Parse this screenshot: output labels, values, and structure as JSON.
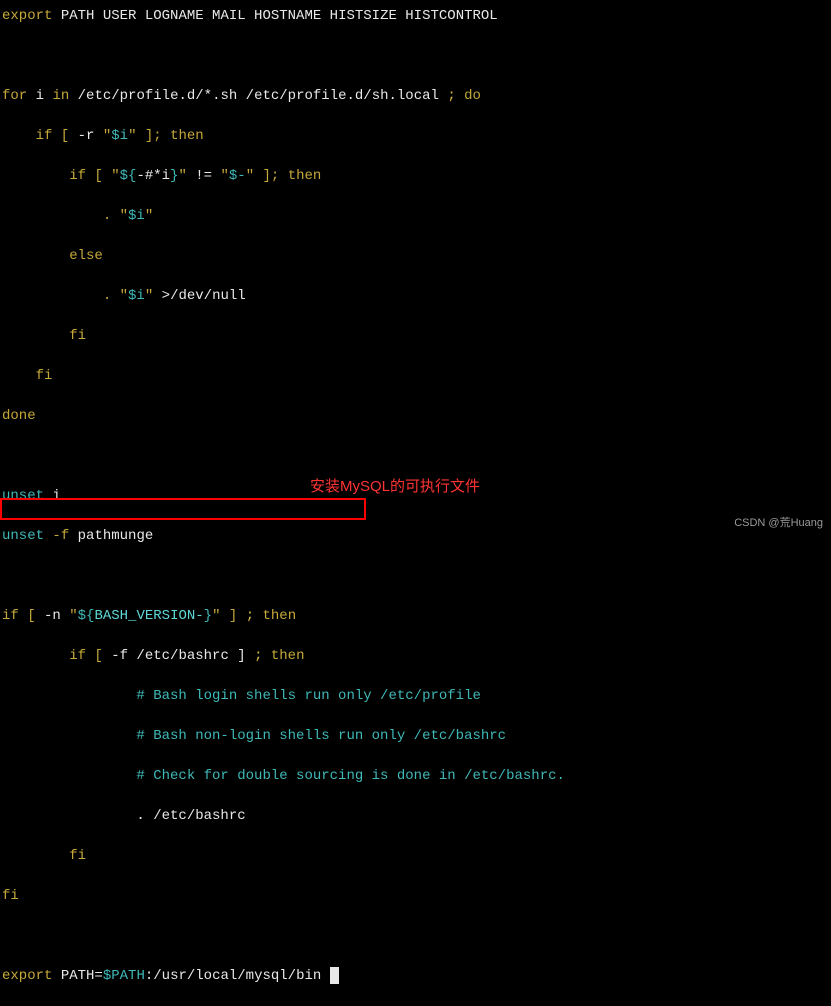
{
  "code": {
    "l1a": "export",
    "l1b": " PATH USER LOGNAME MAIL HOSTNAME HISTSIZE HISTCONTROL",
    "l3a": "for",
    "l3b": " i ",
    "l3c": "in",
    "l3d": " /etc/profile.d/*.sh /etc/profile.d/sh.local ",
    "l3e": ";",
    "l3f": " do",
    "l4a": "    if [ ",
    "l4b": "-r",
    "l4c": " \"",
    "l4d": "$i",
    "l4e": "\" ]; then",
    "l5a": "        if [ \"",
    "l5b": "${",
    "l5c": "-#*i",
    "l5d": "}",
    "l5e": "\" ",
    "l5f": "!=",
    "l5g": " \"",
    "l5h": "$-",
    "l5i": "\" ]; then",
    "l6a": "            . \"",
    "l6b": "$i",
    "l6c": "\"",
    "l7a": "        else",
    "l8a": "            . \"",
    "l8b": "$i",
    "l8c": "\" ",
    "l8d": ">",
    "l8e": "/dev/null",
    "l9a": "        fi",
    "l10a": "    fi",
    "l11a": "done",
    "l13a": "unset",
    "l13b": " i",
    "l14a": "unset",
    "l14b": " -f",
    "l14c": " pathmunge",
    "l16a": "if [ ",
    "l16b": "-n",
    "l16c": " \"",
    "l16d": "${",
    "l16e": "BASH_VERSION-",
    "l16f": "}",
    "l16g": "\" ] ",
    "l16h": ";",
    "l16i": " then",
    "l17a": "        if [ ",
    "l17b": "-f",
    "l17c": " /etc/bashrc ] ",
    "l17d": ";",
    "l17e": " then",
    "l18a": "                # Bash login shells run only /etc/profile",
    "l19a": "                # Bash non-login shells run only /etc/bashrc",
    "l20a": "                # Check for double sourcing is done in /etc/bashrc.",
    "l21a": "                . /etc/bashrc",
    "l22a": "        fi",
    "l23a": "fi",
    "l25a": "export",
    "l25b": " PATH=",
    "l25c": "$PATH",
    "l25d": ":/usr/local/mysql/bin "
  },
  "annotation": "安装MySQL的可执行文件",
  "watermark": "CSDN @荒Huang"
}
